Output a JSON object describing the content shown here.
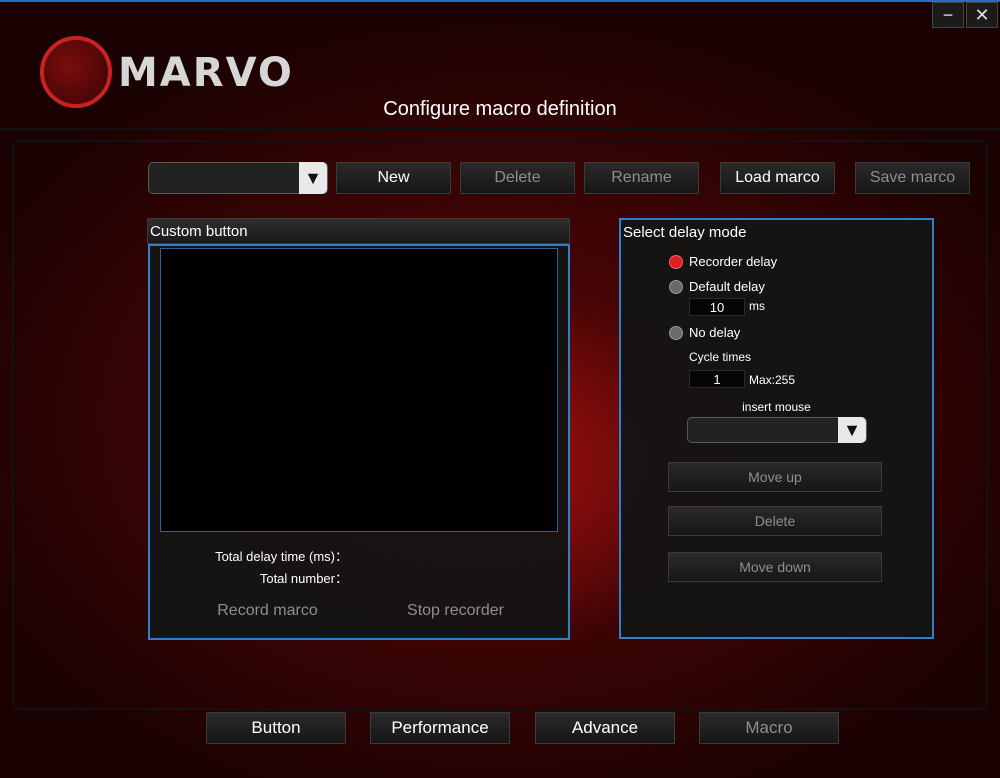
{
  "window": {
    "minimize_icon": "−",
    "close_icon": "✕"
  },
  "brand": {
    "name": "MARVO"
  },
  "page": {
    "title": "Configure macro definition"
  },
  "toolbar": {
    "dropdown_value": "",
    "dropdown_arrow": "▼",
    "new_label": "New",
    "delete_label": "Delete",
    "rename_label": "Rename",
    "load_label": "Load marco",
    "save_label": "Save marco"
  },
  "custom": {
    "header": "Custom button",
    "total_delay_label": "Total delay time (ms)：",
    "total_number_label": "Total number：",
    "record_label": "Record marco",
    "stop_label": "Stop recorder"
  },
  "delay": {
    "header": "Select delay mode",
    "recorder_label": "Recorder delay",
    "default_label": "Default delay",
    "default_value": "10",
    "ms_label": "ms",
    "none_label": "No delay",
    "cycle_label": "Cycle times",
    "cycle_value": "1",
    "max_label": "Max:255",
    "insert_mouse_label": "insert mouse",
    "insert_dropdown_value": "",
    "dropdown_arrow": "▼",
    "move_up_label": "Move up",
    "delete_label": "Delete",
    "move_down_label": "Move down",
    "selected": "recorder",
    "radio_selected_color": "#e02020"
  },
  "bottom_tabs": {
    "button_label": "Button",
    "performance_label": "Performance",
    "advance_label": "Advance",
    "macro_label": "Macro"
  }
}
